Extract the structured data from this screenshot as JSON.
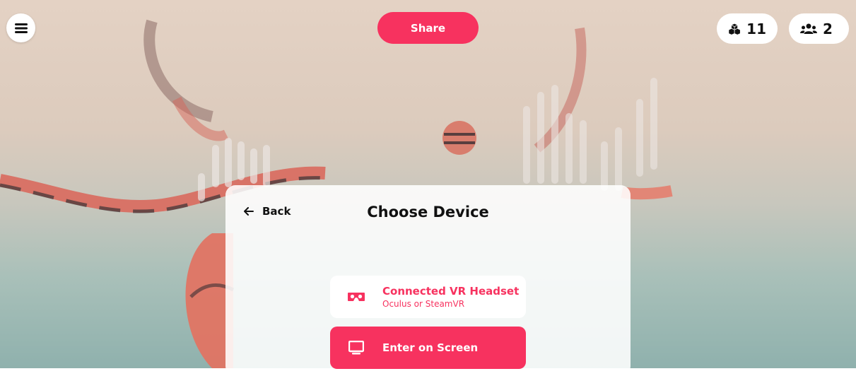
{
  "header": {
    "menu_icon": "hamburger-menu-icon",
    "share_label": "Share",
    "objects_icon": "cubes-icon",
    "objects_count": "11",
    "users_icon": "users-icon",
    "users_count": "2"
  },
  "dialog": {
    "back_label": "Back",
    "title": "Choose Device",
    "options": [
      {
        "icon": "vr-headset-icon",
        "label": "Connected VR Headset",
        "sublabel": "Oculus or SteamVR"
      },
      {
        "icon": "monitor-icon",
        "label": "Enter on Screen"
      }
    ]
  },
  "colors": {
    "accent": "#f7325f",
    "panel": "#ffffff",
    "background_top": "#e4d2c4",
    "background_bottom": "#8fb1ad"
  }
}
